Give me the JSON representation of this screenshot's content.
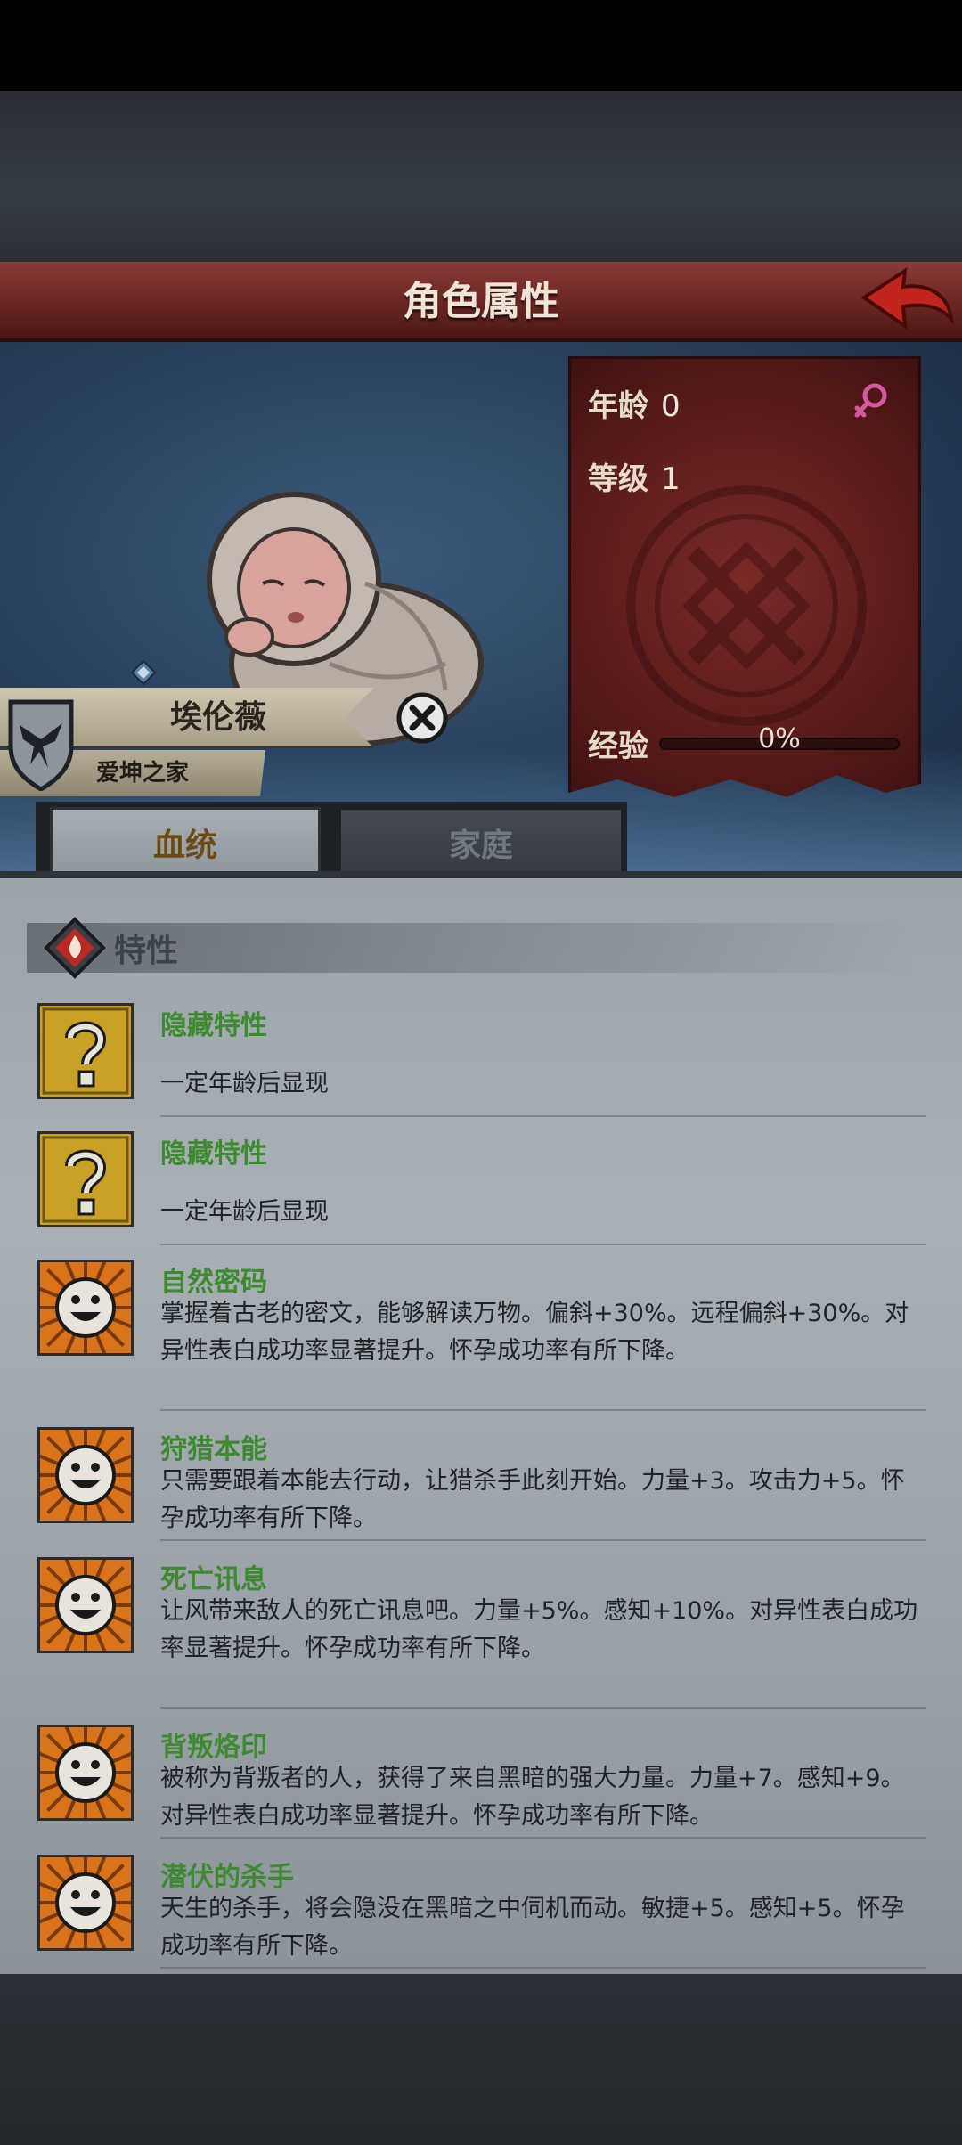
{
  "header": {
    "title": "角色属性"
  },
  "character": {
    "name": "埃伦薇",
    "family": "爱坤之家",
    "stats": {
      "age_label": "年龄",
      "age": "0",
      "level_label": "等级",
      "level": "1",
      "exp_label": "经验",
      "exp_percent": "0%",
      "exp_value": 0
    }
  },
  "tabs": [
    {
      "label": "血统",
      "active": true
    },
    {
      "label": "家庭",
      "active": false
    }
  ],
  "section": {
    "title": "特性"
  },
  "traits": [
    {
      "name": "隐藏特性",
      "desc": "一定年龄后显现",
      "icon": "question-icon"
    },
    {
      "name": "隐藏特性",
      "desc": "一定年龄后显现",
      "icon": "question-icon"
    },
    {
      "name": "自然密码",
      "desc": "掌握着古老的密文，能够解读万物。偏斜+30%。远程偏斜+30%。对异性表白成功率显著提升。怀孕成功率有所下降。",
      "icon": "smiley-sun-icon"
    },
    {
      "name": "狩猎本能",
      "desc": "只需要跟着本能去行动，让猎杀手此刻开始。力量+3。攻击力+5。怀孕成功率有所下降。",
      "icon": "smiley-sun-icon"
    },
    {
      "name": "死亡讯息",
      "desc": "让风带来敌人的死亡讯息吧。力量+5%。感知+10%。对异性表白成功率显著提升。怀孕成功率有所下降。",
      "icon": "smiley-sun-icon"
    },
    {
      "name": "背叛烙印",
      "desc": "被称为背叛者的人，获得了来自黑暗的强大力量。力量+7。感知+9。对异性表白成功率显著提升。怀孕成功率有所下降。",
      "icon": "smiley-sun-icon"
    },
    {
      "name": "潜伏的杀手",
      "desc": "天生的杀手，将会隐没在黑暗之中伺机而动。敏捷+5。感知+5。怀孕成功率有所下降。",
      "icon": "smiley-sun-icon"
    }
  ],
  "colors": {
    "header": "#6a2623",
    "trait_name": "#3e8a2e",
    "tab_active_text": "#6b4b10"
  }
}
